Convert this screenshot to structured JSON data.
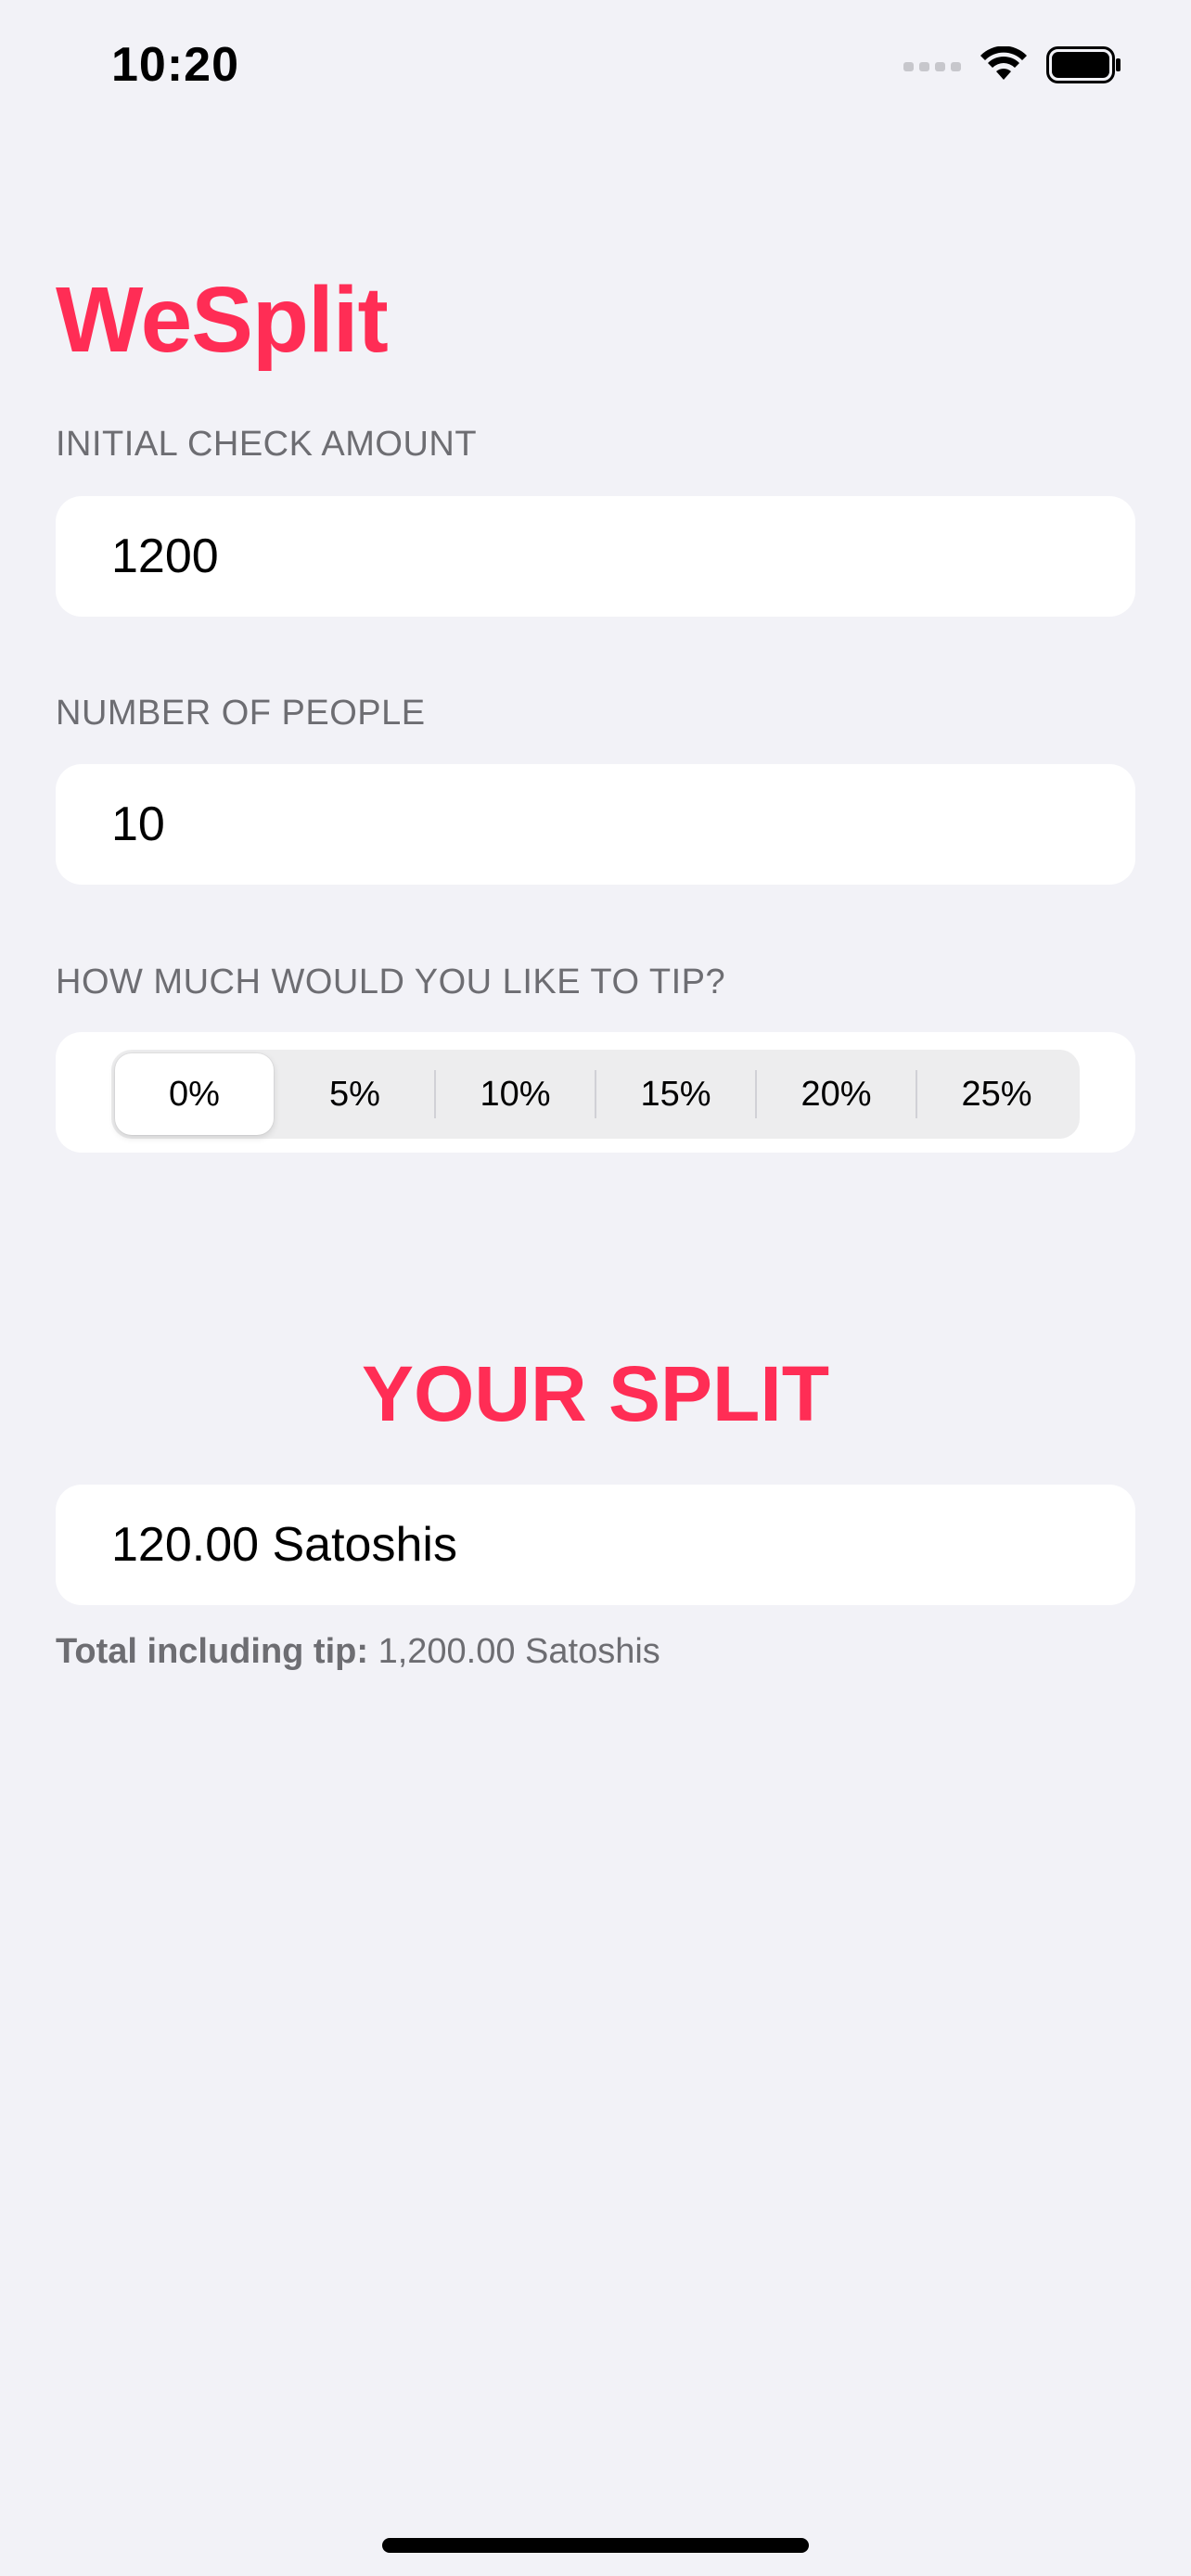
{
  "status_bar": {
    "time": "10:20",
    "icons": [
      "cellular-signal-icon",
      "wifi-icon",
      "battery-icon"
    ]
  },
  "app": {
    "title": "WeSplit",
    "accent_color": "#FF2D55"
  },
  "check_section": {
    "header": "INITIAL CHECK AMOUNT",
    "value": "1200"
  },
  "people_section": {
    "header": "NUMBER OF PEOPLE",
    "value": "10"
  },
  "tip_section": {
    "header": "HOW MUCH WOULD YOU LIKE TO TIP?",
    "options": [
      "0%",
      "5%",
      "10%",
      "15%",
      "20%",
      "25%"
    ],
    "selected": "0%"
  },
  "split_section": {
    "title": "YOUR SPLIT",
    "amount": "120.00 Satoshis",
    "total_label": "Total including tip:",
    "total_value": "1,200.00 Satoshis"
  }
}
